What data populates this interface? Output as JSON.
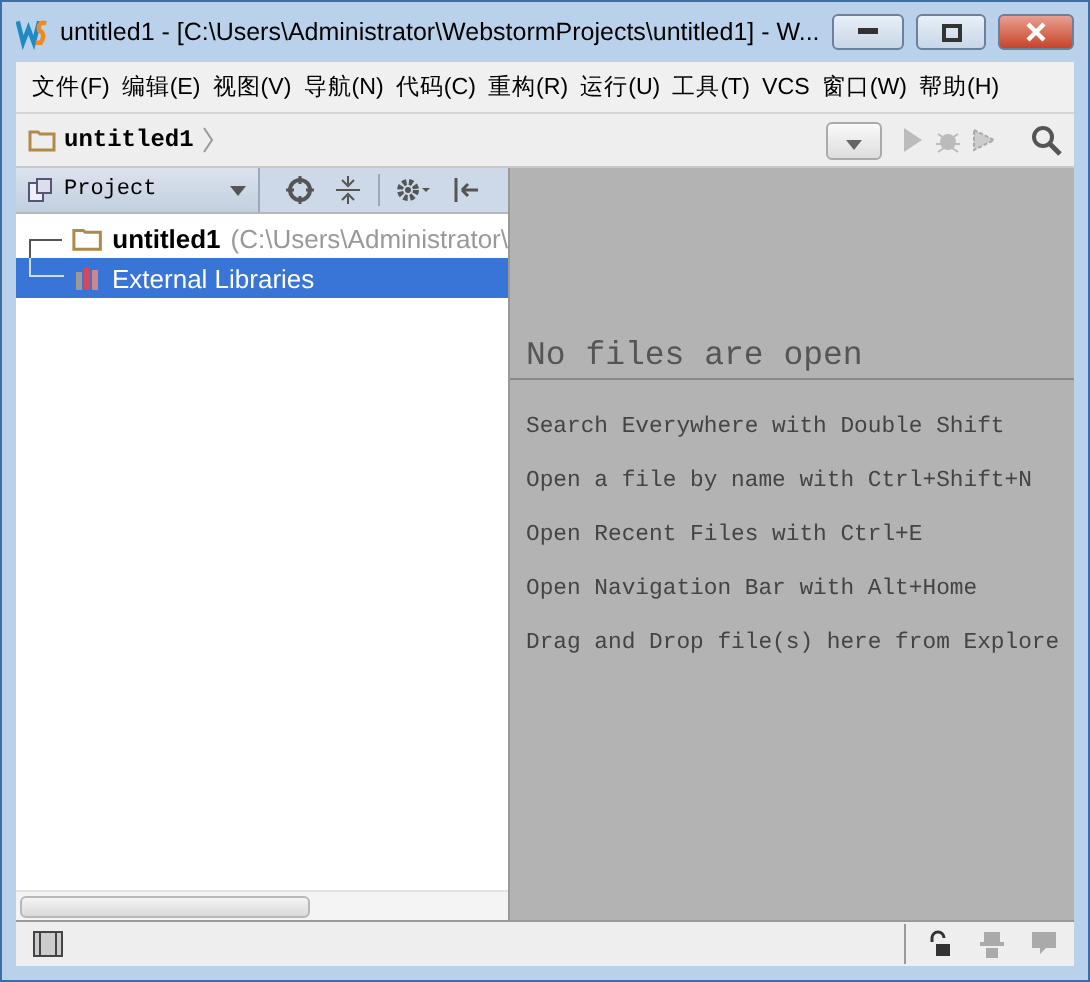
{
  "window": {
    "title": "untitled1 - [C:\\Users\\Administrator\\WebstormProjects\\untitled1] - W..."
  },
  "menu": [
    {
      "label": "文件(F)"
    },
    {
      "label": "编辑(E)"
    },
    {
      "label": "视图(V)"
    },
    {
      "label": "导航(N)"
    },
    {
      "label": "代码(C)"
    },
    {
      "label": "重构(R)"
    },
    {
      "label": "运行(U)"
    },
    {
      "label": "工具(T)"
    },
    {
      "label": "VCS"
    },
    {
      "label": "窗口(W)"
    },
    {
      "label": "帮助(H)"
    }
  ],
  "breadcrumb": {
    "label": "untitled1"
  },
  "project_panel": {
    "view_selector": "Project",
    "tree": [
      {
        "label": "untitled1",
        "path": "(C:\\Users\\Administrator\\",
        "kind": "project",
        "selected": false
      },
      {
        "label": "External Libraries",
        "kind": "libraries",
        "selected": true
      }
    ]
  },
  "editor": {
    "empty_title": "No files are open",
    "hints": [
      "Search Everywhere with Double Shift",
      "Open a file by name with Ctrl+Shift+N",
      "Open Recent Files with Ctrl+E",
      "Open Navigation Bar with Alt+Home",
      "Drag and Drop file(s) here from Explore"
    ]
  }
}
